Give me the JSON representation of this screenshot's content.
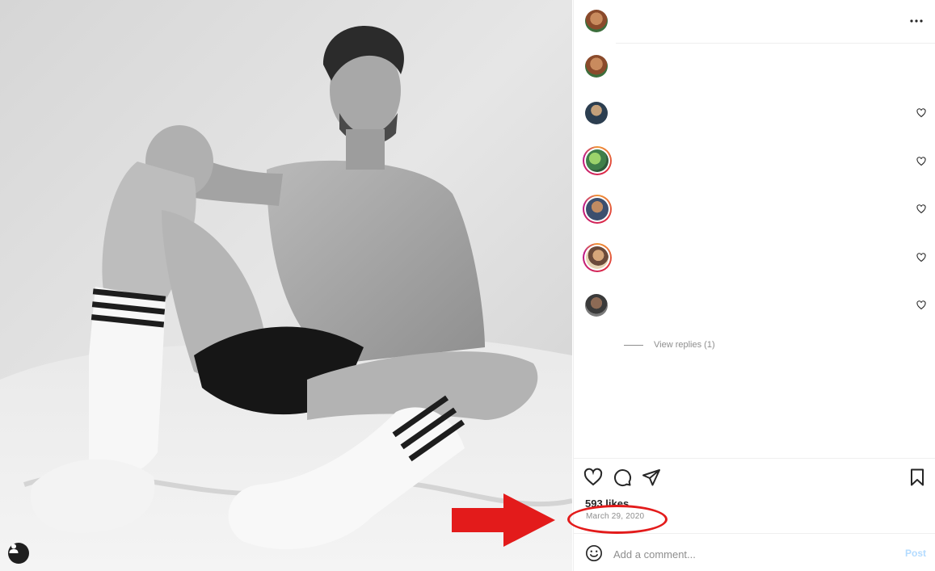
{
  "post": {
    "likes_text": "593 likes",
    "date": "March 29, 2020"
  },
  "comments": {
    "view_replies": "View replies (1)"
  },
  "comment_box": {
    "placeholder": "Add a comment...",
    "post_label": "Post"
  },
  "icons": {
    "more": "more-options-icon",
    "like": "heart-icon",
    "comment": "comment-bubble-icon",
    "share": "send-icon",
    "save": "bookmark-icon",
    "emoji": "emoji-icon",
    "user_tag": "user-icon"
  },
  "colors": {
    "annotation_red": "#e31b1b",
    "post_button_disabled": "#b3dbff",
    "muted_text": "#8e8e8e"
  }
}
